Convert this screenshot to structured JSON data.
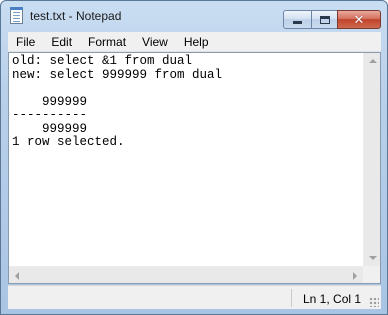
{
  "window": {
    "title": "test.txt - Notepad",
    "close_glyph": "✕"
  },
  "menu": {
    "items": [
      "File",
      "Edit",
      "Format",
      "View",
      "Help"
    ]
  },
  "editor": {
    "content": "old: select &1 from dual\nnew: select 999999 from dual\n\n    999999\n----------\n    999999\n1 row selected."
  },
  "status": {
    "position": "Ln 1, Col 1"
  },
  "icons": {
    "app": "notepad-icon",
    "minimize": "minimize-icon",
    "maximize": "maximize-icon",
    "close": "close-icon"
  }
}
